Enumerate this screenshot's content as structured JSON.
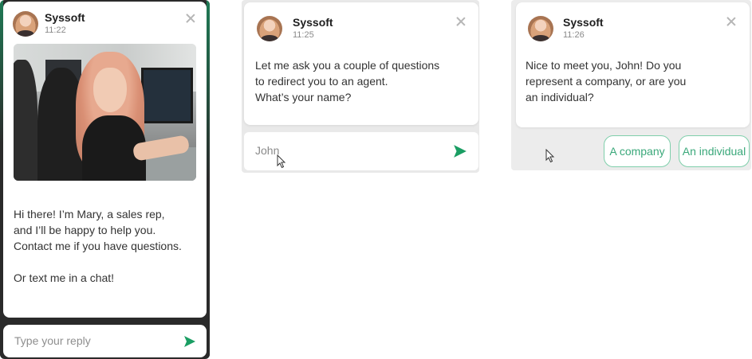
{
  "brand": {
    "accent": "#1a9e63",
    "button_border": "#7fcfab",
    "button_text": "#3aa87a"
  },
  "widgets": [
    {
      "sender": "Syssoft",
      "time": "11:22",
      "avatar_icon": "avatar-photo",
      "close_icon": "close-icon",
      "message": "Hi there! I’m Mary, a sales rep,\nand I’ll be happy to help you.\nContact me if you have questions.\n\nOr text me in a chat!",
      "input_placeholder": "Type your reply",
      "send_icon": "send-icon"
    },
    {
      "sender": "Syssoft",
      "time": "11:25",
      "message": "Let me ask you a couple of questions\nto redirect you to an agent.\nWhat’s your name?",
      "input_value": "John",
      "send_icon": "send-icon"
    },
    {
      "sender": "Syssoft",
      "time": "11:26",
      "message": "Nice to meet you, John! Do you\nrepresent a company, or are you\nan individual?",
      "options": [
        "A company",
        "An individual"
      ]
    }
  ]
}
